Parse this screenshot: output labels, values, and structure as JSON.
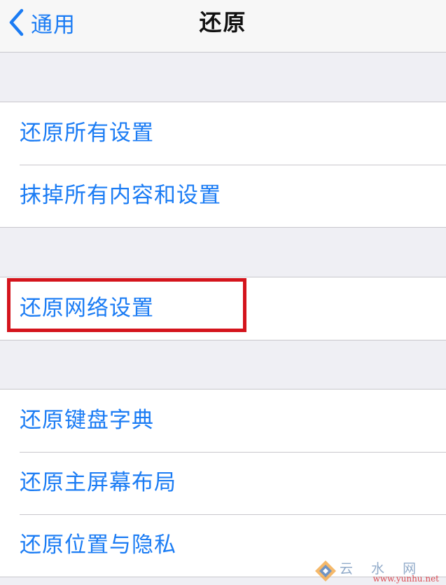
{
  "navbar": {
    "back_label": "通用",
    "title": "还原"
  },
  "groups": [
    {
      "items": [
        "还原所有设置",
        "抹掉所有内容和设置"
      ]
    },
    {
      "items": [
        "还原网络设置"
      ]
    },
    {
      "items": [
        "还原键盘字典",
        "还原主屏幕布局",
        "还原位置与隐私"
      ]
    }
  ],
  "highlighted_item": "还原网络设置",
  "watermark": {
    "text": "云 水 网",
    "url": "www.yunhu.net"
  },
  "colors": {
    "accent": "#1b7cf4",
    "highlight_border": "#d4141c",
    "background": "#efeff4"
  }
}
